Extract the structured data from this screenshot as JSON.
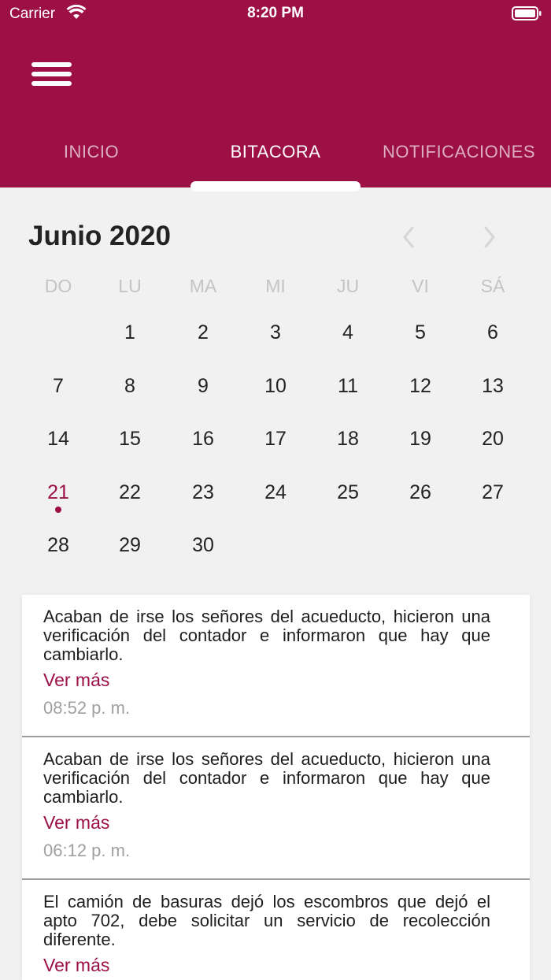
{
  "status_bar": {
    "carrier": "Carrier",
    "time": "8:20 PM"
  },
  "colors": {
    "brand": "#9c1046",
    "background": "#f2f1f1"
  },
  "tabs": [
    {
      "label": "INICIO",
      "active": false
    },
    {
      "label": "BITACORA",
      "active": true
    },
    {
      "label": "NOTIFICACIONES",
      "active": false
    }
  ],
  "calendar": {
    "month_title": "Junio 2020",
    "weekdays": [
      "DO",
      "LU",
      "MA",
      "MI",
      "JU",
      "VI",
      "SÁ"
    ],
    "days": [
      "1",
      "2",
      "3",
      "4",
      "5",
      "6",
      "7",
      "8",
      "9",
      "10",
      "11",
      "12",
      "13",
      "14",
      "15",
      "16",
      "17",
      "18",
      "19",
      "20",
      "21",
      "22",
      "23",
      "24",
      "25",
      "26",
      "27",
      "28",
      "29",
      "30"
    ],
    "selected_day": "21"
  },
  "entries": [
    {
      "text": "Acaban de irse los señores del acueducto, hicieron una verificación del contador e informaron que hay que cambiarlo.",
      "more": "Ver más",
      "time": "08:52 p. m."
    },
    {
      "text": "Acaban de irse los señores del acueducto, hicieron una verificación del contador e informaron que hay que cambiarlo.",
      "more": "Ver más",
      "time": "06:12 p. m."
    },
    {
      "text": "El camión de basuras dejó los escombros que dejó el apto 702, debe solicitar un servicio de recolección diferente.",
      "more": "Ver más",
      "time": ""
    }
  ]
}
